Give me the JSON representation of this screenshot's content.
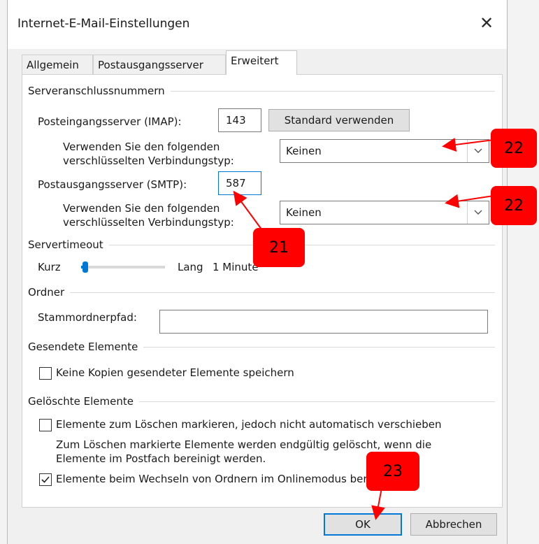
{
  "window": {
    "title": "Internet-E-Mail-Einstellungen",
    "close_glyph": "✕"
  },
  "tabs": [
    {
      "label": "Allgemein",
      "active": false
    },
    {
      "label": "Postausgangsserver",
      "active": false
    },
    {
      "label": "Erweitert",
      "active": true
    }
  ],
  "server_ports": {
    "heading": "Serveranschlussnummern",
    "incoming_label": "Posteingangsserver (IMAP):",
    "incoming_value": "143",
    "default_button": "Standard verwenden",
    "encryption_label_line1": "Verwenden Sie den folgenden",
    "encryption_label_line2": "verschlüsselten Verbindungstyp:",
    "incoming_encryption": "Keinen",
    "outgoing_label": "Postausgangsserver (SMTP):",
    "outgoing_value": "587",
    "outgoing_encryption": "Keinen"
  },
  "timeout": {
    "heading": "Servertimeout",
    "short_label": "Kurz",
    "long_label": "Lang",
    "value_text": "1 Minute",
    "level_fraction": 0.05
  },
  "folders": {
    "heading": "Ordner",
    "root_label": "Stammordnerpfad:",
    "root_value": ""
  },
  "sent": {
    "heading": "Gesendete Elemente",
    "no_copies_label": "Keine Kopien gesendeter Elemente speichern",
    "no_copies_checked": false
  },
  "deleted": {
    "heading": "Gelöschte Elemente",
    "mark_label": "Elemente zum Löschen markieren, jedoch nicht automatisch verschieben",
    "mark_checked": false,
    "note_line1": "Zum Löschen markierte Elemente werden endgültig gelöscht, wenn die",
    "note_line2": "Elemente im Postfach bereinigt werden.",
    "purge_label": "Elemente beim Wechseln von Ordnern im Onlinemodus bereinigen",
    "purge_checked": true
  },
  "footer": {
    "ok_label": "OK",
    "cancel_label": "Abbrechen"
  },
  "annotations": [
    {
      "label": "22",
      "target": "incoming-encryption-select"
    },
    {
      "label": "22",
      "target": "outgoing-encryption-select"
    },
    {
      "label": "21",
      "target": "outgoing-port-input"
    },
    {
      "label": "23",
      "target": "ok-button"
    }
  ],
  "colors": {
    "annotation_red": "#ff0000",
    "focus_blue": "#0078d7",
    "slider_blue": "#0078d7"
  }
}
